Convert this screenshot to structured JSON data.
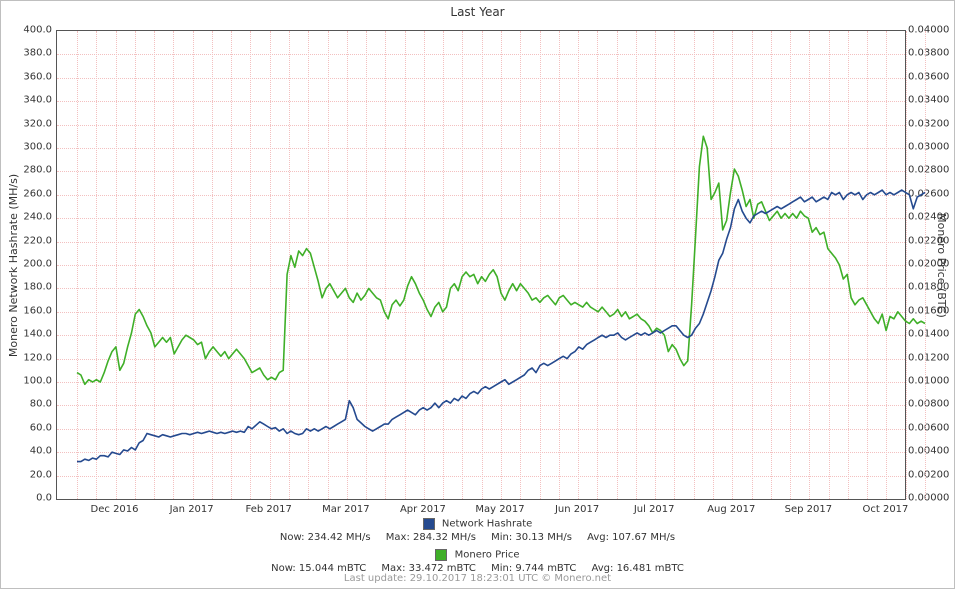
{
  "title": "Last Year",
  "left_axis_label": "Monero Network Hashrate (MH/s)",
  "right_axis_label": "Monero Price (BTC)",
  "last_update": "Last update: 29.10.2017 18:23:01 UTC © Monero.net",
  "colors": {
    "hashrate": "#254A8F",
    "price": "#3FAF28",
    "grid": "#f3c0c0"
  },
  "left_ticks": [
    "0.0",
    "20.0",
    "40.0",
    "60.0",
    "80.0",
    "100.0",
    "120.0",
    "140.0",
    "160.0",
    "180.0",
    "200.0",
    "220.0",
    "240.0",
    "260.0",
    "280.0",
    "300.0",
    "320.0",
    "340.0",
    "360.0",
    "380.0",
    "400.0"
  ],
  "right_ticks": [
    "0.00000",
    "0.00200",
    "0.00400",
    "0.00600",
    "0.00800",
    "0.01000",
    "0.01200",
    "0.01400",
    "0.01600",
    "0.01800",
    "0.02000",
    "0.02200",
    "0.02400",
    "0.02600",
    "0.02800",
    "0.03000",
    "0.03200",
    "0.03400",
    "0.03600",
    "0.03800",
    "0.04000"
  ],
  "x_ticks": [
    "Dec 2016",
    "Jan 2017",
    "Feb 2017",
    "Mar 2017",
    "Apr 2017",
    "May 2017",
    "Jun 2017",
    "Jul 2017",
    "Aug 2017",
    "Sep 2017",
    "Oct 2017"
  ],
  "legend": {
    "hashrate": {
      "name": "Network Hashrate",
      "now": "Now: 234.42 MH/s",
      "max": "Max: 284.32 MH/s",
      "min": "Min: 30.13 MH/s",
      "avg": "Avg: 107.67 MH/s"
    },
    "price": {
      "name": "Monero Price",
      "now": "Now: 15.044 mBTC",
      "max": "Max: 33.472 mBTC",
      "min": "Min: 9.744 mBTC",
      "avg": "Avg: 16.481 mBTC"
    }
  },
  "chart_data": {
    "type": "line",
    "title": "Last Year",
    "xlabel": "",
    "ylabel_left": "Monero Network Hashrate (MH/s)",
    "ylabel_right": "Monero Price (BTC)",
    "ylim_left": [
      0,
      400
    ],
    "ylim_right": [
      0,
      0.04
    ],
    "categories": [
      "Dec 2016",
      "Jan 2017",
      "Feb 2017",
      "Mar 2017",
      "Apr 2017",
      "May 2017",
      "Jun 2017",
      "Jul 2017",
      "Aug 2017",
      "Sep 2017",
      "Oct 2017"
    ],
    "series": [
      {
        "name": "Network Hashrate",
        "axis": "left",
        "color": "#254A8F",
        "x": [
          0,
          0.05,
          0.1,
          0.15,
          0.2,
          0.25,
          0.3,
          0.35,
          0.4,
          0.45,
          0.5,
          0.55,
          0.6,
          0.65,
          0.7,
          0.75,
          0.8,
          0.85,
          0.9,
          0.95,
          1.0,
          1.05,
          1.1,
          1.15,
          1.2,
          1.25,
          1.3,
          1.35,
          1.4,
          1.45,
          1.5,
          1.55,
          1.6,
          1.65,
          1.7,
          1.75,
          1.8,
          1.85,
          1.9,
          1.95,
          2.0,
          2.05,
          2.1,
          2.15,
          2.2,
          2.25,
          2.3,
          2.35,
          2.4,
          2.45,
          2.5,
          2.55,
          2.6,
          2.65,
          2.7,
          2.75,
          2.8,
          2.85,
          2.9,
          2.95,
          3.0,
          3.05,
          3.1,
          3.15,
          3.2,
          3.25,
          3.3,
          3.35,
          3.4,
          3.45,
          3.5,
          3.55,
          3.6,
          3.65,
          3.7,
          3.75,
          3.8,
          3.85,
          3.9,
          3.95,
          4.0,
          4.05,
          4.1,
          4.15,
          4.2,
          4.25,
          4.3,
          4.35,
          4.4,
          4.45,
          4.5,
          4.55,
          4.6,
          4.65,
          4.7,
          4.75,
          4.8,
          4.85,
          4.9,
          4.95,
          5.0,
          5.05,
          5.1,
          5.15,
          5.2,
          5.25,
          5.3,
          5.35,
          5.4,
          5.45,
          5.5,
          5.55,
          5.6,
          5.65,
          5.7,
          5.75,
          5.8,
          5.85,
          5.9,
          5.95,
          6.0,
          6.05,
          6.1,
          6.15,
          6.2,
          6.25,
          6.3,
          6.35,
          6.4,
          6.45,
          6.5,
          6.55,
          6.6,
          6.65,
          6.7,
          6.75,
          6.8,
          6.85,
          6.9,
          6.95,
          7.0,
          7.05,
          7.1,
          7.15,
          7.2,
          7.25,
          7.3,
          7.35,
          7.4,
          7.45,
          7.5,
          7.55,
          7.6,
          7.65,
          7.7,
          7.75,
          7.8,
          7.85,
          7.9,
          7.95,
          8.0,
          8.05,
          8.1,
          8.15,
          8.2,
          8.25,
          8.3,
          8.35,
          8.4,
          8.45,
          8.5,
          8.55,
          8.6,
          8.65,
          8.7,
          8.75,
          8.8,
          8.85,
          8.9,
          8.95,
          9.0,
          9.05,
          9.1,
          9.15,
          9.2,
          9.25,
          9.3,
          9.35,
          9.4,
          9.45,
          9.5,
          9.55,
          9.6,
          9.65,
          9.7,
          9.75,
          9.8,
          9.85,
          9.9,
          9.95,
          10.0,
          10.05,
          10.1,
          10.15,
          10.2,
          10.25,
          10.3,
          10.35,
          10.4,
          10.45,
          10.5,
          10.55,
          10.6,
          10.65,
          10.7,
          10.75,
          10.8,
          10.85,
          10.9
        ],
        "values": [
          32,
          32,
          34,
          33,
          35,
          34,
          37,
          37,
          36,
          40,
          39,
          38,
          42,
          41,
          44,
          42,
          48,
          50,
          56,
          55,
          54,
          53,
          55,
          54,
          53,
          54,
          55,
          56,
          56,
          55,
          56,
          57,
          56,
          57,
          58,
          57,
          56,
          57,
          56,
          57,
          58,
          57,
          58,
          57,
          62,
          60,
          63,
          66,
          64,
          62,
          60,
          61,
          58,
          60,
          56,
          58,
          56,
          55,
          56,
          60,
          58,
          60,
          58,
          60,
          62,
          60,
          62,
          64,
          66,
          68,
          84,
          78,
          68,
          65,
          62,
          60,
          58,
          60,
          62,
          64,
          64,
          68,
          70,
          72,
          74,
          76,
          74,
          72,
          76,
          78,
          76,
          78,
          82,
          78,
          82,
          84,
          82,
          86,
          84,
          88,
          86,
          90,
          92,
          90,
          94,
          96,
          94,
          96,
          98,
          100,
          102,
          98,
          100,
          102,
          104,
          106,
          110,
          112,
          108,
          114,
          116,
          114,
          116,
          118,
          120,
          122,
          120,
          124,
          126,
          130,
          128,
          132,
          134,
          136,
          138,
          140,
          138,
          140,
          140,
          142,
          138,
          136,
          138,
          140,
          142,
          140,
          142,
          140,
          142,
          144,
          142,
          144,
          146,
          148,
          148,
          144,
          140,
          138,
          140,
          146,
          150,
          158,
          168,
          178,
          190,
          204,
          210,
          222,
          232,
          248,
          256,
          246,
          240,
          236,
          242,
          244,
          246,
          244,
          246,
          248,
          250,
          248,
          250,
          252,
          254,
          256,
          258,
          254,
          256,
          258,
          254,
          256,
          258,
          256,
          262,
          260,
          262,
          256,
          260,
          262,
          260,
          262,
          256,
          260,
          262,
          260,
          262,
          264,
          260,
          262,
          260,
          262,
          264,
          262,
          260,
          248,
          258,
          260,
          262
        ]
      },
      {
        "name": "Monero Price",
        "axis": "right",
        "color": "#3FAF28",
        "x": [
          0,
          0.05,
          0.1,
          0.15,
          0.2,
          0.25,
          0.3,
          0.35,
          0.4,
          0.45,
          0.5,
          0.55,
          0.6,
          0.65,
          0.7,
          0.75,
          0.8,
          0.85,
          0.9,
          0.95,
          1.0,
          1.05,
          1.1,
          1.15,
          1.2,
          1.25,
          1.3,
          1.35,
          1.4,
          1.45,
          1.5,
          1.55,
          1.6,
          1.65,
          1.7,
          1.75,
          1.8,
          1.85,
          1.9,
          1.95,
          2.0,
          2.05,
          2.1,
          2.15,
          2.2,
          2.25,
          2.3,
          2.35,
          2.4,
          2.45,
          2.5,
          2.55,
          2.6,
          2.65,
          2.7,
          2.75,
          2.8,
          2.85,
          2.9,
          2.95,
          3.0,
          3.05,
          3.1,
          3.15,
          3.2,
          3.25,
          3.3,
          3.35,
          3.4,
          3.45,
          3.5,
          3.55,
          3.6,
          3.65,
          3.7,
          3.75,
          3.8,
          3.85,
          3.9,
          3.95,
          4.0,
          4.05,
          4.1,
          4.15,
          4.2,
          4.25,
          4.3,
          4.35,
          4.4,
          4.45,
          4.5,
          4.55,
          4.6,
          4.65,
          4.7,
          4.75,
          4.8,
          4.85,
          4.9,
          4.95,
          5.0,
          5.05,
          5.1,
          5.15,
          5.2,
          5.25,
          5.3,
          5.35,
          5.4,
          5.45,
          5.5,
          5.55,
          5.6,
          5.65,
          5.7,
          5.75,
          5.8,
          5.85,
          5.9,
          5.95,
          6.0,
          6.05,
          6.1,
          6.15,
          6.2,
          6.25,
          6.3,
          6.35,
          6.4,
          6.45,
          6.5,
          6.55,
          6.6,
          6.65,
          6.7,
          6.75,
          6.8,
          6.85,
          6.9,
          6.95,
          7.0,
          7.05,
          7.1,
          7.15,
          7.2,
          7.25,
          7.3,
          7.35,
          7.4,
          7.45,
          7.5,
          7.55,
          7.6,
          7.65,
          7.7,
          7.75,
          7.8,
          7.85,
          7.9,
          7.95,
          8.0,
          8.05,
          8.1,
          8.15,
          8.2,
          8.25,
          8.3,
          8.35,
          8.4,
          8.45,
          8.5,
          8.55,
          8.6,
          8.65,
          8.7,
          8.75,
          8.8,
          8.85,
          8.9,
          8.95,
          9.0,
          9.05,
          9.1,
          9.15,
          9.2,
          9.25,
          9.3,
          9.35,
          9.4,
          9.45,
          9.5,
          9.55,
          9.6,
          9.65,
          9.7,
          9.75,
          9.8,
          9.85,
          9.9,
          9.95,
          10.0,
          10.05,
          10.1,
          10.15,
          10.2,
          10.25,
          10.3,
          10.35,
          10.4,
          10.45,
          10.5,
          10.55,
          10.6,
          10.65,
          10.7,
          10.75,
          10.8,
          10.85,
          10.9
        ],
        "values": [
          0.0108,
          0.0106,
          0.0098,
          0.0102,
          0.01,
          0.0102,
          0.01,
          0.0108,
          0.0118,
          0.0126,
          0.013,
          0.011,
          0.0116,
          0.013,
          0.0142,
          0.0158,
          0.0162,
          0.0156,
          0.0148,
          0.0142,
          0.013,
          0.0134,
          0.0138,
          0.0134,
          0.0138,
          0.0124,
          0.013,
          0.0136,
          0.014,
          0.0138,
          0.0136,
          0.0132,
          0.0134,
          0.012,
          0.0126,
          0.013,
          0.0126,
          0.0122,
          0.0126,
          0.012,
          0.0124,
          0.0128,
          0.0124,
          0.012,
          0.0114,
          0.0108,
          0.011,
          0.0112,
          0.0106,
          0.0102,
          0.0104,
          0.0102,
          0.0108,
          0.011,
          0.0192,
          0.0208,
          0.0198,
          0.0212,
          0.0208,
          0.0214,
          0.021,
          0.0198,
          0.0186,
          0.0172,
          0.018,
          0.0184,
          0.0178,
          0.0172,
          0.0176,
          0.018,
          0.0172,
          0.0168,
          0.0176,
          0.017,
          0.0174,
          0.018,
          0.0176,
          0.0172,
          0.017,
          0.016,
          0.0154,
          0.0166,
          0.017,
          0.0165,
          0.017,
          0.0182,
          0.019,
          0.0184,
          0.0176,
          0.017,
          0.0162,
          0.0156,
          0.0164,
          0.0168,
          0.016,
          0.0164,
          0.018,
          0.0184,
          0.0178,
          0.019,
          0.0194,
          0.019,
          0.0192,
          0.0184,
          0.019,
          0.0186,
          0.0192,
          0.0196,
          0.019,
          0.0176,
          0.017,
          0.0178,
          0.0184,
          0.0178,
          0.0184,
          0.018,
          0.0176,
          0.017,
          0.0172,
          0.0168,
          0.0172,
          0.0174,
          0.017,
          0.0166,
          0.0172,
          0.0174,
          0.017,
          0.0166,
          0.0168,
          0.0166,
          0.0164,
          0.0168,
          0.0164,
          0.0162,
          0.016,
          0.0164,
          0.016,
          0.0156,
          0.0158,
          0.0162,
          0.0156,
          0.016,
          0.0154,
          0.0156,
          0.0158,
          0.0154,
          0.0152,
          0.0148,
          0.0142,
          0.0146,
          0.0144,
          0.014,
          0.0126,
          0.0132,
          0.0128,
          0.012,
          0.0114,
          0.0118,
          0.0166,
          0.0224,
          0.0284,
          0.031,
          0.03,
          0.0256,
          0.0262,
          0.027,
          0.023,
          0.0238,
          0.0262,
          0.0282,
          0.0276,
          0.0264,
          0.025,
          0.0256,
          0.024,
          0.0252,
          0.0254,
          0.0246,
          0.0238,
          0.0242,
          0.0246,
          0.024,
          0.0244,
          0.024,
          0.0244,
          0.024,
          0.0246,
          0.0242,
          0.024,
          0.0228,
          0.0232,
          0.0226,
          0.0228,
          0.0214,
          0.021,
          0.0206,
          0.02,
          0.0188,
          0.0192,
          0.0172,
          0.0166,
          0.017,
          0.0172,
          0.0166,
          0.016,
          0.0154,
          0.015,
          0.0158,
          0.0144,
          0.0156,
          0.0154,
          0.016,
          0.0156,
          0.0152,
          0.015,
          0.0154,
          0.015,
          0.0152,
          0.015
        ]
      }
    ]
  }
}
